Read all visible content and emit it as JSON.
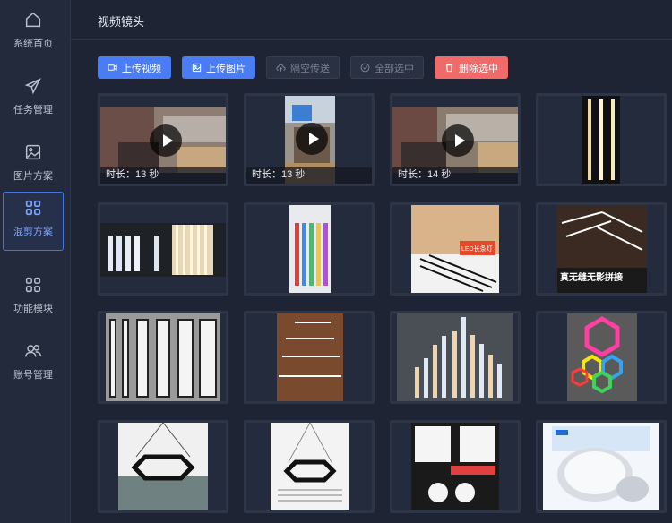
{
  "sidebar": {
    "items": [
      {
        "label": "系统首页",
        "icon": "home-icon"
      },
      {
        "label": "任务管理",
        "icon": "paper-plane-icon"
      },
      {
        "label": "图片方案",
        "icon": "image-icon"
      },
      {
        "label": "混剪方案",
        "icon": "grid-icon",
        "active": true
      },
      {
        "label": "功能模块",
        "icon": "modules-icon"
      },
      {
        "label": "账号管理",
        "icon": "users-icon"
      }
    ]
  },
  "header": {
    "title": "视频镜头"
  },
  "toolbar": {
    "upload_video": "上传视频",
    "upload_image": "上传图片",
    "airdrop": "隔空传送",
    "select_all": "全部选中",
    "delete_selected": "删除选中"
  },
  "media": [
    {
      "type": "video",
      "duration": "时长：13 秒"
    },
    {
      "type": "video",
      "duration": "时长：13 秒"
    },
    {
      "type": "video",
      "duration": "时长：14 秒"
    },
    {
      "type": "image"
    },
    {
      "type": "image"
    },
    {
      "type": "image"
    },
    {
      "type": "image",
      "caption": "LED长条灯"
    },
    {
      "type": "image",
      "caption": "真无缝无影拼接"
    },
    {
      "type": "image"
    },
    {
      "type": "image"
    },
    {
      "type": "image"
    },
    {
      "type": "image"
    },
    {
      "type": "image"
    },
    {
      "type": "image"
    },
    {
      "type": "image"
    },
    {
      "type": "image"
    }
  ],
  "colors": {
    "primary": "#4a7cf3",
    "danger": "#f06a6a",
    "sidebar": "#232a3b",
    "background": "#1e2434"
  }
}
